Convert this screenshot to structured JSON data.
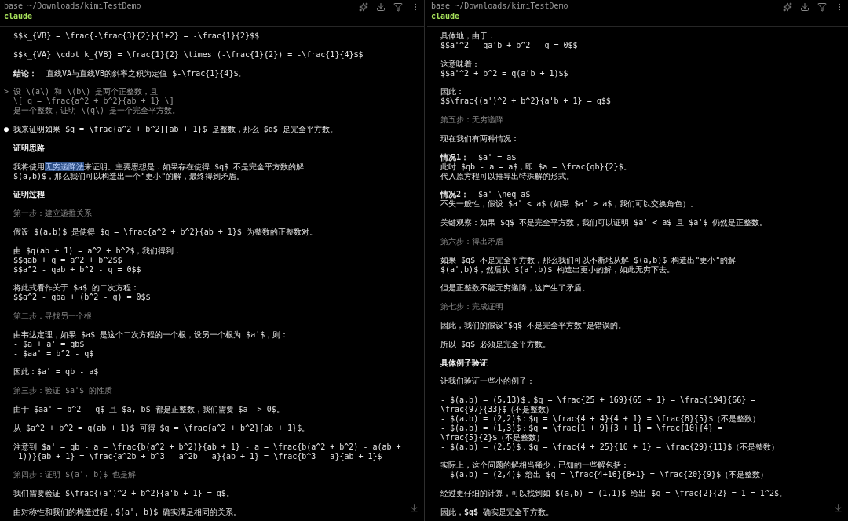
{
  "panes": [
    {
      "path": "base ~/Downloads/kimiTestDemo",
      "command": "claude",
      "paragraphs": [
        {
          "kind": "text",
          "lines": [
            "$$k_{VB} = \\frac{-\\frac{3}{2}}{1+2} = -\\frac{1}{2}$$"
          ]
        },
        {
          "kind": "text",
          "lines": [
            "$$k_{VA} \\cdot k_{VB} = \\frac{1}{2} \\times (-\\frac{1}{2}) = -\\frac{1}{4}$$"
          ]
        },
        {
          "kind": "text",
          "lines": [
            "**结论：**  直线VA与直线VB的斜率之积为定值 $-\\frac{1}{4}$。"
          ]
        },
        {
          "kind": "prompt",
          "marker": ">",
          "lines": [
            "设 \\(a\\) 和 \\(b\\) 是两个正整数，且",
            "\\[ q = \\frac{a^2 + b^2}{ab + 1} \\]",
            "是一个整数，证明 \\(q\\) 是一个完全平方数。"
          ]
        },
        {
          "kind": "bullet",
          "marker": "●",
          "lines": [
            "我来证明如果 $q = \\frac{a^2 + b^2}{ab + 1}$ 是整数，那么 $q$ 是完全平方数。"
          ]
        },
        {
          "kind": "heading",
          "lines": [
            "证明思路"
          ]
        },
        {
          "kind": "text",
          "lines": [
            [
              {
                "text": "我将使用",
                "selected": false
              },
              {
                "text": "无穷递降法",
                "selected": true
              },
              {
                "text": "来证明。主要思想是：如果存在使得 $q$ 不是完全平方数的解",
                "selected": false
              }
            ],
            "$(a,b)$，那么我们可以构造出一个\"更小\"的解，最终得到矛盾。"
          ]
        },
        {
          "kind": "heading",
          "lines": [
            "证明过程"
          ]
        },
        {
          "kind": "step",
          "lines": [
            "第一步：建立递推关系"
          ]
        },
        {
          "kind": "text",
          "lines": [
            "假设 $(a,b)$ 是使得 $q = \\frac{a^2 + b^2}{ab + 1}$ 为整数的正整数对。"
          ]
        },
        {
          "kind": "text",
          "lines": [
            "由 $q(ab + 1) = a^2 + b^2$，我们得到：",
            "$$qab + q = a^2 + b^2$$",
            "$$a^2 - qab + b^2 - q = 0$$"
          ]
        },
        {
          "kind": "text",
          "lines": [
            "将此式看作关于 $a$ 的二次方程：",
            "$$a^2 - qba + (b^2 - q) = 0$$"
          ]
        },
        {
          "kind": "step",
          "lines": [
            "第二步：寻找另一个根"
          ]
        },
        {
          "kind": "text",
          "lines": [
            "由韦达定理，如果 $a$ 是这个二次方程的一个根，设另一个根为 $a'$，则：",
            "- $a + a' = qb$",
            "- $aa' = b^2 - q$"
          ]
        },
        {
          "kind": "text",
          "lines": [
            "因此：$a' = qb - a$"
          ]
        },
        {
          "kind": "step",
          "lines": [
            "第三步：验证 $a'$ 的性质"
          ]
        },
        {
          "kind": "text",
          "lines": [
            "由于 $aa' = b^2 - q$ 且 $a, b$ 都是正整数，我们需要 $a' > 0$。"
          ]
        },
        {
          "kind": "text",
          "lines": [
            "从 $a^2 + b^2 = q(ab + 1)$ 可得 $q = \\frac{a^2 + b^2}{ab + 1}$。"
          ]
        },
        {
          "kind": "text",
          "lines": [
            "注意到 $a' = qb - a = \\frac{b(a^2 + b^2)}{ab + 1} - a = \\frac{b(a^2 + b^2) - a(ab +",
            " 1))}{ab + 1} = \\frac{a^2b + b^3 - a^2b - a}{ab + 1} = \\frac{b^3 - a}{ab + 1}$"
          ]
        },
        {
          "kind": "step",
          "lines": [
            "第四步：证明 $(a', b)$ 也是解"
          ]
        },
        {
          "kind": "text",
          "lines": [
            "我们需要验证 $\\frac{(a')^2 + b^2}{a'b + 1} = q$。"
          ]
        },
        {
          "kind": "text",
          "lines": [
            "由对称性和我们的构造过程，$(a', b)$ 确实满足相同的关系。"
          ]
        }
      ]
    },
    {
      "path": "base ~/Downloads/kimiTestDemo",
      "command": "claude",
      "paragraphs": [
        {
          "kind": "text",
          "lines": [
            "具体地，由于：",
            "$$a'^2 - qa'b + b^2 - q = 0$$"
          ]
        },
        {
          "kind": "text",
          "lines": [
            "这意味着：",
            "$$a'^2 + b^2 = q(a'b + 1)$$"
          ]
        },
        {
          "kind": "text",
          "lines": [
            "因此：",
            "$$\\frac{(a')^2 + b^2}{a'b + 1} = q$$"
          ]
        },
        {
          "kind": "step",
          "lines": [
            "第五步：无穷递降"
          ]
        },
        {
          "kind": "text",
          "lines": [
            "现在我们有两种情况："
          ]
        },
        {
          "kind": "text",
          "lines": [
            "**情况1：**  $a' = a$",
            "此时 $qb - a = a$，即 $a = \\frac{qb}{2}$。",
            "代入原方程可以推导出特殊解的形式。"
          ]
        },
        {
          "kind": "text",
          "lines": [
            "**情况2：**  $a' \\neq a$",
            "不失一般性，假设 $a' < a$（如果 $a' > a$，我们可以交换角色）。"
          ]
        },
        {
          "kind": "text",
          "lines": [
            "关键观察：如果 $q$ 不是完全平方数，我们可以证明 $a' < a$ 且 $a'$ 仍然是正整数。"
          ]
        },
        {
          "kind": "step",
          "lines": [
            "第六步：得出矛盾"
          ]
        },
        {
          "kind": "text",
          "lines": [
            "如果 $q$ 不是完全平方数，那么我们可以不断地从解 $(a,b)$ 构造出\"更小\"的解",
            "$(a',b)$，然后从 $(a',b)$ 构造出更小的解，如此无穷下去。"
          ]
        },
        {
          "kind": "text",
          "lines": [
            "但是正整数不能无穷递降，这产生了矛盾。"
          ]
        },
        {
          "kind": "step",
          "lines": [
            "第七步：完成证明"
          ]
        },
        {
          "kind": "text",
          "lines": [
            "因此，我们的假设\"$q$ 不是完全平方数\"是错误的。"
          ]
        },
        {
          "kind": "text",
          "lines": [
            "所以 $q$ 必须是完全平方数。"
          ]
        },
        {
          "kind": "heading",
          "lines": [
            "具体例子验证"
          ]
        },
        {
          "kind": "text",
          "lines": [
            "让我们验证一些小的例子："
          ]
        },
        {
          "kind": "text",
          "lines": [
            "- $(a,b) = (5,13)$：$q = \\frac{25 + 169}{65 + 1} = \\frac{194}{66} =",
            "\\frac{97}{33}$（不是整数）",
            "- $(a,b) = (2,2)$：$q = \\frac{4 + 4}{4 + 1} = \\frac{8}{5}$（不是整数）",
            "- $(a,b) = (1,3)$：$q = \\frac{1 + 9}{3 + 1} = \\frac{10}{4} =",
            "\\frac{5}{2}$（不是整数）",
            "- $(a,b) = (2,5)$：$q = \\frac{4 + 25}{10 + 1} = \\frac{29}{11}$（不是整数）"
          ]
        },
        {
          "kind": "text",
          "lines": [
            "实际上，这个问题的解相当稀少，已知的一些解包括：",
            "- $(a,b) = (2,4)$ 给出 $q = \\frac{4+16}{8+1} = \\frac{20}{9}$（不是整数）"
          ]
        },
        {
          "kind": "text",
          "lines": [
            "经过更仔细的计算，可以找到如 $(a,b) = (1,1)$ 给出 $q = \\frac{2}{2} = 1 = 1^2$。"
          ]
        },
        {
          "kind": "text",
          "lines": [
            "因此，**$q$** 确实是完全平方数。"
          ]
        }
      ]
    }
  ]
}
